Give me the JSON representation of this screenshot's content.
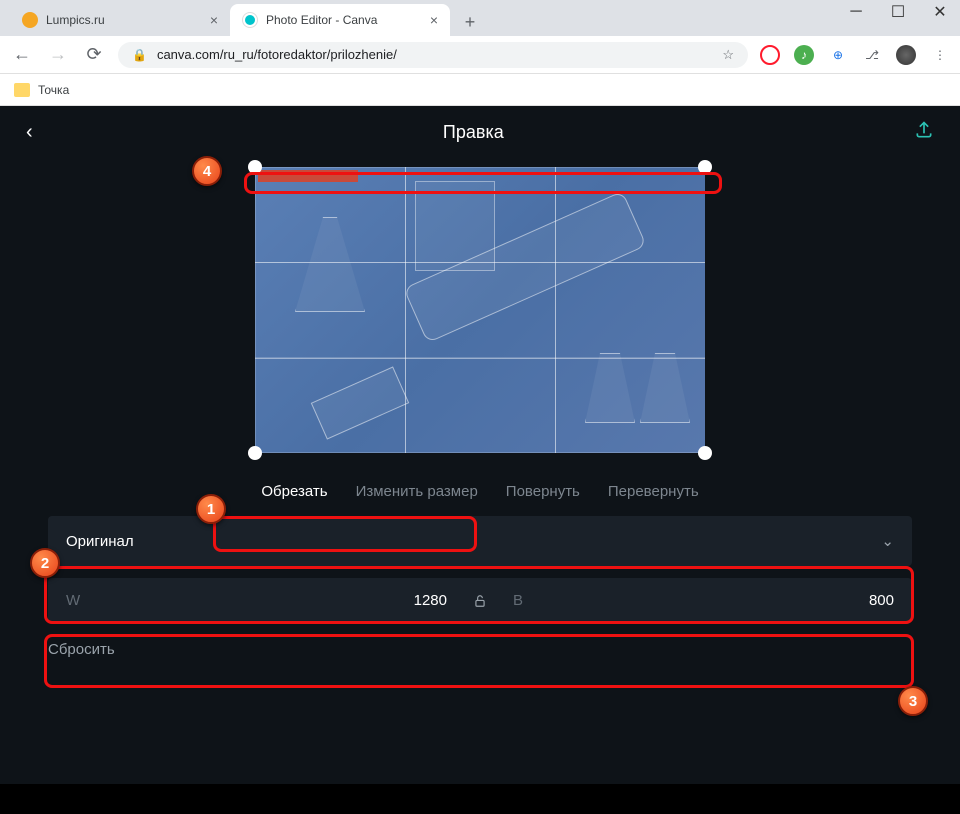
{
  "browser": {
    "tabs": [
      {
        "title": "Lumpics.ru",
        "favicon_color": "#f5a623"
      },
      {
        "title": "Photo Editor - Canva",
        "favicon_color": "#00c4cc"
      }
    ],
    "url": "canva.com/ru_ru/fotoredaktor/prilozhenie/",
    "bookmark": "Точка"
  },
  "app": {
    "header_title": "Правка",
    "tabs": {
      "crop": "Обрезать",
      "resize": "Изменить размер",
      "rotate": "Повернуть",
      "flip": "Перевернуть"
    },
    "dropdown_label": "Оригинал",
    "dims": {
      "w_label": "W",
      "w_value": "1280",
      "h_label": "В",
      "h_value": "800"
    },
    "reset_label": "Сбросить"
  },
  "annotations": {
    "b1": "1",
    "b2": "2",
    "b3": "3",
    "b4": "4"
  }
}
